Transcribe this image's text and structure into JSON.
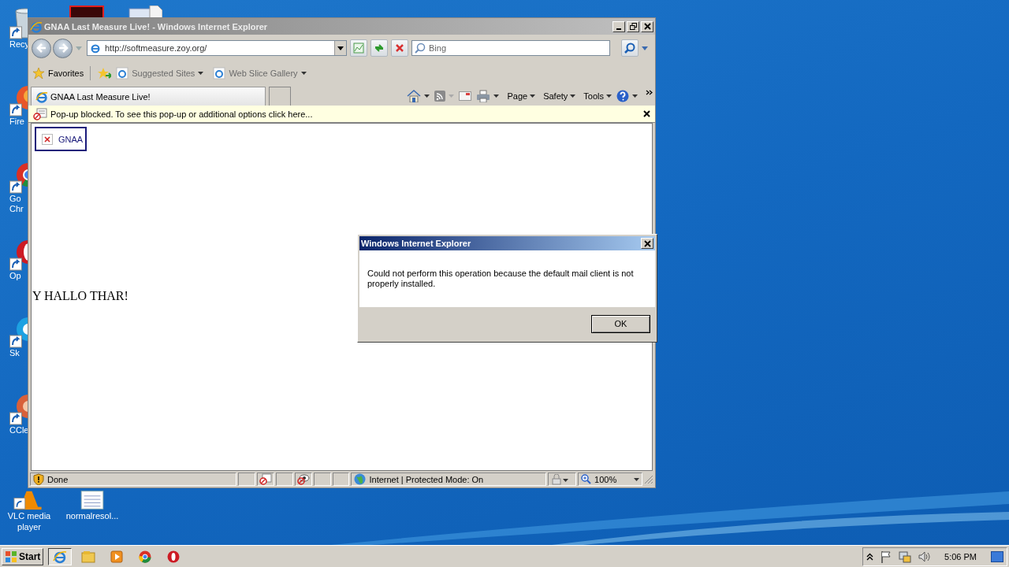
{
  "desktop": {
    "top_icons": [
      {
        "kind": "red-app"
      },
      {
        "kind": "document"
      }
    ],
    "column_icons": [
      {
        "kind": "recycle",
        "label": "Recy"
      },
      {
        "kind": "firefox",
        "label": "Fire"
      },
      {
        "kind": "chrome",
        "label": "Go Chr"
      },
      {
        "kind": "opera",
        "label": "Op"
      },
      {
        "kind": "skype",
        "label": "Sk"
      },
      {
        "kind": "ccleaner",
        "label": "CCle"
      }
    ],
    "bottom_icons": [
      {
        "kind": "vlc",
        "label": "VLC media player"
      },
      {
        "kind": "text-file",
        "label": "normalresol..."
      }
    ]
  },
  "window": {
    "title": "GNAA Last Measure Live! - Windows Internet Explorer",
    "address": "http://softmeasure.zoy.org/",
    "search": {
      "placeholder": "Bing"
    },
    "favorites_bar": {
      "favorites": "Favorites",
      "links": [
        "Suggested Sites",
        "Web Slice Gallery"
      ]
    },
    "tab": {
      "title": "GNAA Last Measure Live!"
    },
    "command_bar": [
      "Page",
      "Safety",
      "Tools"
    ],
    "info_bar": "Pop-up blocked. To see this pop-up or additional options click here...",
    "page": {
      "image_alt": "GNAA",
      "text": "Y HALLO THAR!"
    },
    "status_bar": {
      "status": "Done",
      "zone": "Internet | Protected Mode: On",
      "zoom": "100%"
    }
  },
  "dialog": {
    "title": "Windows Internet Explorer",
    "message": "Could not perform this operation because the default mail client is not properly installed.",
    "button": "OK"
  },
  "taskbar": {
    "start": "Start",
    "clock": "5:06 PM"
  }
}
